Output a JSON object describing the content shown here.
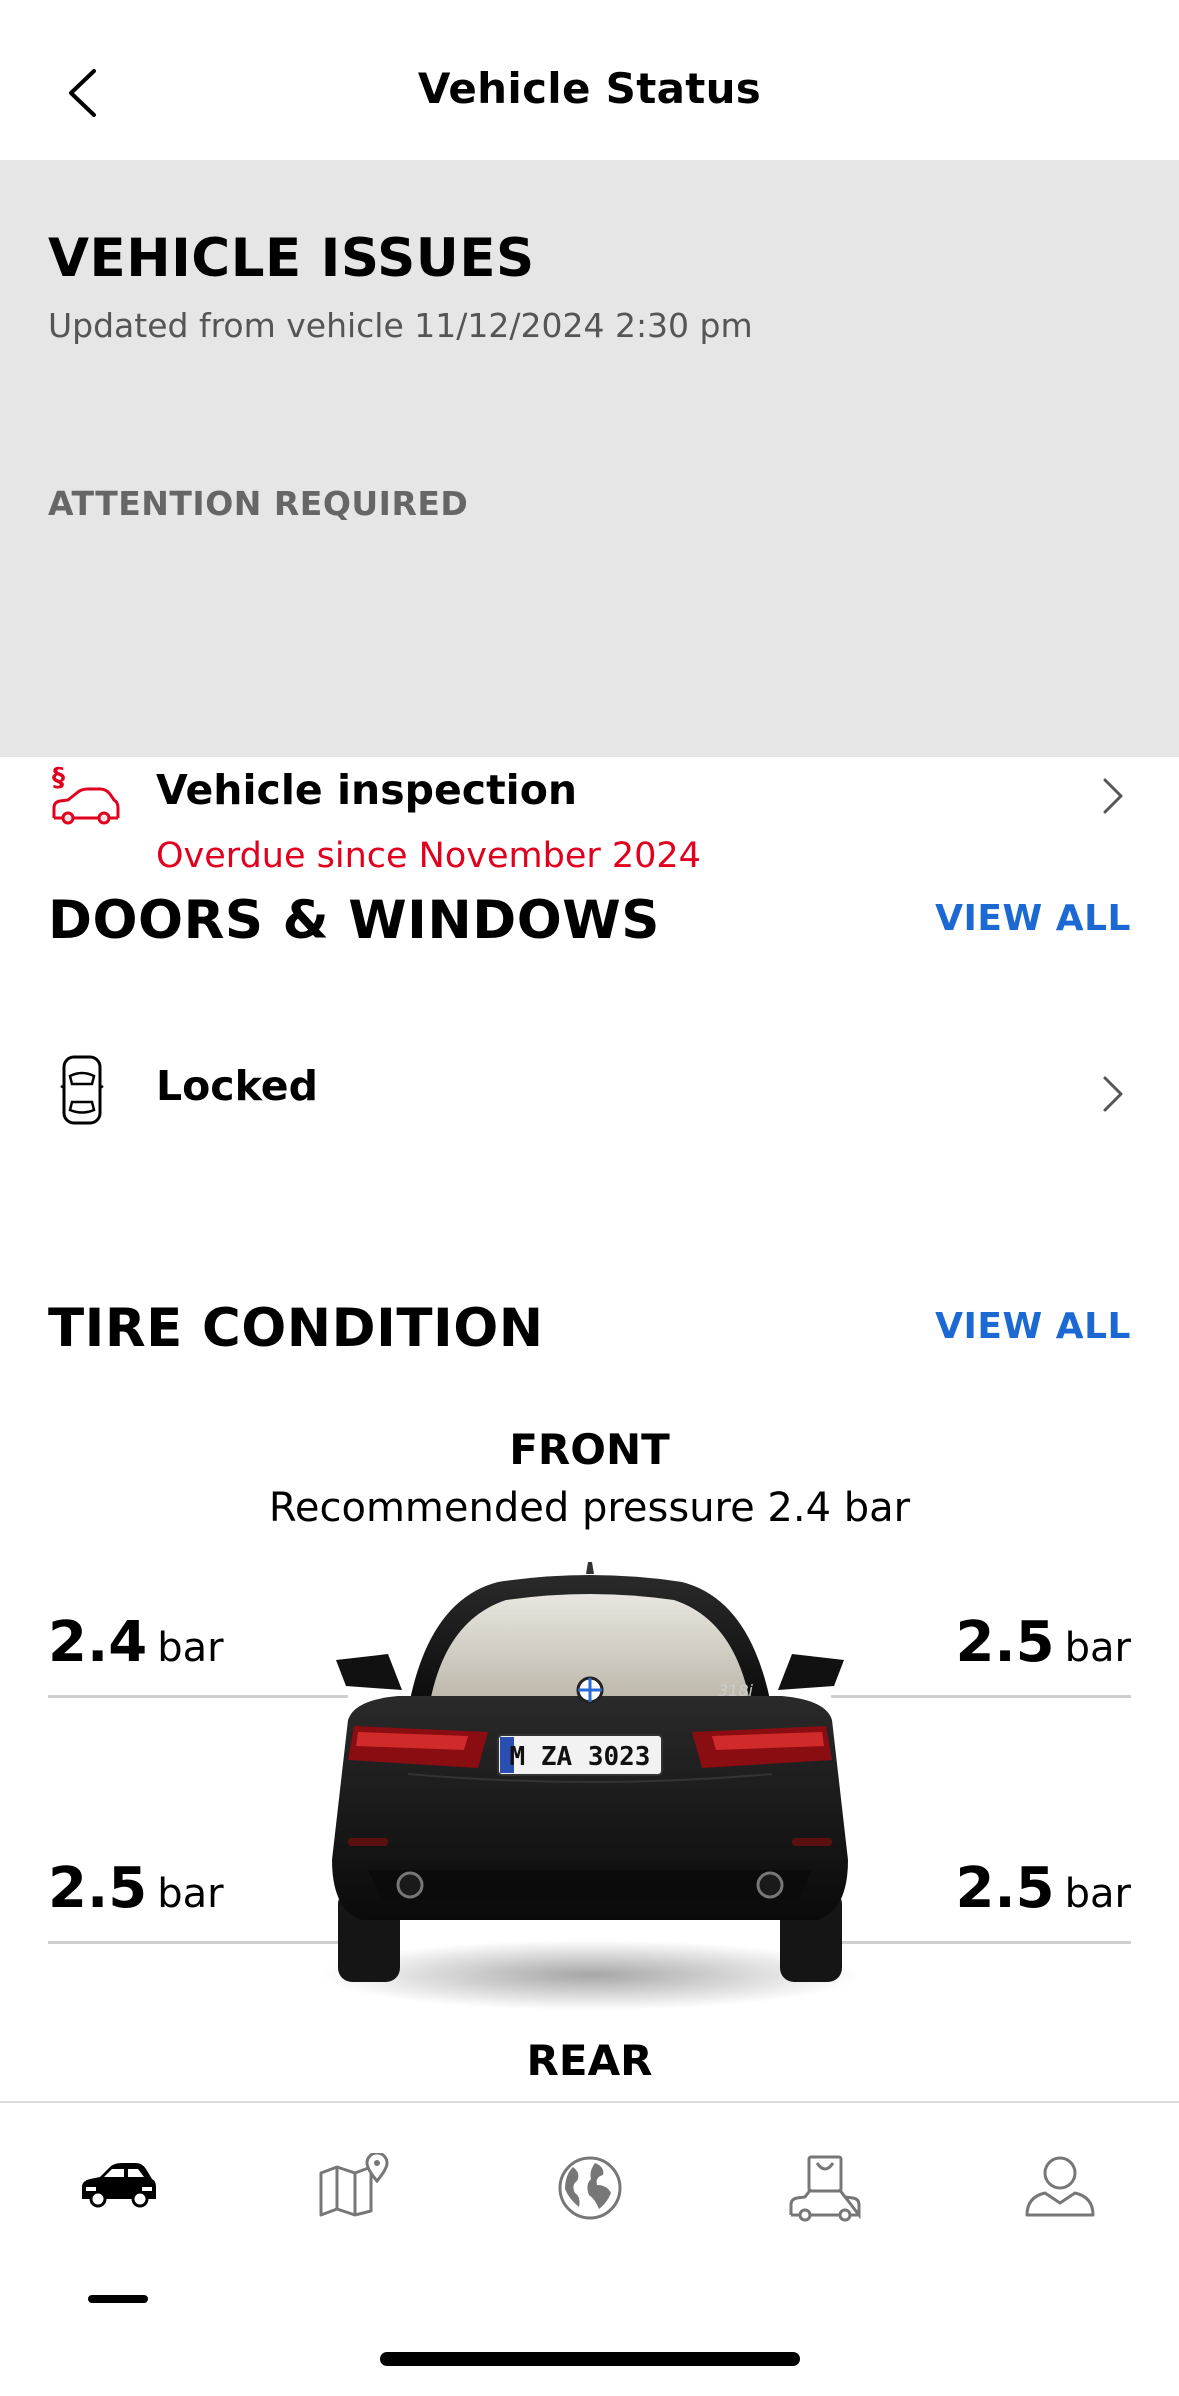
{
  "header": {
    "title": "Vehicle Status"
  },
  "vehicle_issues": {
    "title": "VEHICLE ISSUES",
    "updated": "Updated from vehicle 11/12/2024 2:30 pm",
    "attention_label": "ATTENTION REQUIRED",
    "items": [
      {
        "title": "Vehicle inspection",
        "subtitle": "Overdue since November 2024",
        "icon": "inspection-car-icon"
      }
    ]
  },
  "doors_windows": {
    "title": "DOORS & WINDOWS",
    "view_all": "VIEW ALL",
    "status": "Locked",
    "icon": "car-top-view-icon"
  },
  "tire_condition": {
    "title": "TIRE CONDITION",
    "view_all": "VIEW ALL",
    "front_label": "FRONT",
    "recommended": "Recommended pressure 2.4 bar",
    "rear_label": "REAR",
    "unit": "bar",
    "front_left": "2.4",
    "front_right": "2.5",
    "rear_left": "2.5",
    "rear_right": "2.5",
    "license_plate": "M ZA 3023",
    "model_badge": "318i"
  },
  "tabbar": {
    "tabs": [
      {
        "name": "vehicle",
        "icon": "car-icon",
        "active": true
      },
      {
        "name": "map",
        "icon": "map-pin-icon",
        "active": false
      },
      {
        "name": "world",
        "icon": "globe-icon",
        "active": false
      },
      {
        "name": "shop",
        "icon": "shop-car-icon",
        "active": false
      },
      {
        "name": "profile",
        "icon": "person-icon",
        "active": false
      }
    ]
  },
  "colors": {
    "accent": "#1c69d4",
    "alert": "#e1001e",
    "issues_bg": "#e6e6e6"
  }
}
